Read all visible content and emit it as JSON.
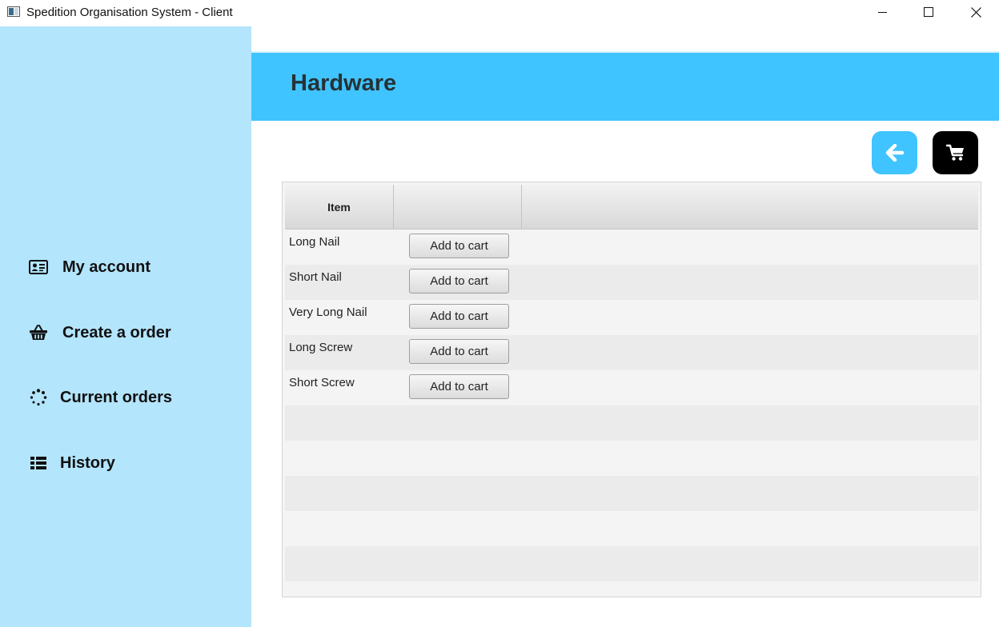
{
  "window": {
    "title": "Spedition Organisation System - Client"
  },
  "sidebar": {
    "items": [
      {
        "label": "My account",
        "icon": "id-card-icon"
      },
      {
        "label": "Create a order",
        "icon": "basket-icon"
      },
      {
        "label": "Current orders",
        "icon": "spinner-icon"
      },
      {
        "label": "History",
        "icon": "list-icon"
      }
    ]
  },
  "header": {
    "title": "Hardware",
    "color": "#40c4ff"
  },
  "actions": {
    "back_icon": "arrow-left-icon",
    "cart_icon": "shopping-cart-icon"
  },
  "table": {
    "columns": [
      "Item",
      ""
    ],
    "rows": [
      {
        "item": "Long Nail",
        "action": "Add to cart"
      },
      {
        "item": "Short Nail",
        "action": "Add to cart"
      },
      {
        "item": "Very Long Nail",
        "action": "Add to cart"
      },
      {
        "item": "Long Screw",
        "action": "Add to cart"
      },
      {
        "item": "Short Screw",
        "action": "Add to cart"
      }
    ]
  },
  "colors": {
    "sidebar_bg": "#b3e5fc",
    "accent": "#40c4ff",
    "cart_button": "#000000"
  }
}
